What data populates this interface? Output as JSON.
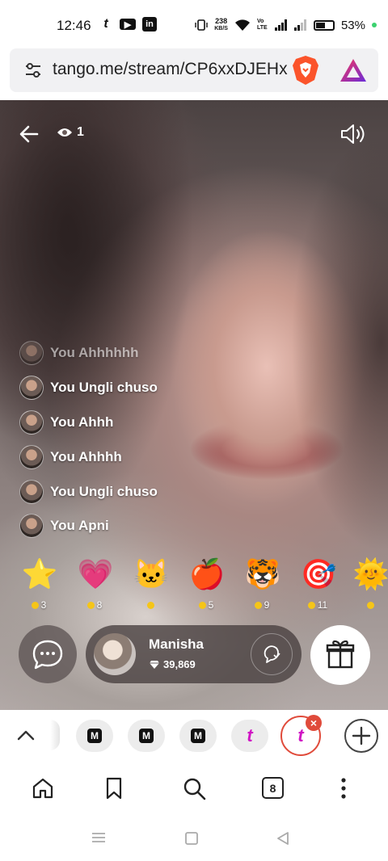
{
  "status_bar": {
    "time": "12:46",
    "left_icons": [
      "tango-icon",
      "youtube-icon",
      "linkedin-icon"
    ],
    "net_speed_value": "238",
    "net_speed_unit": "KB/S",
    "vo_lte": "Vo LTE",
    "battery_percent": "53%",
    "battery_level": 0.53
  },
  "browser": {
    "url": "tango.me/stream/CP6xxDJEHx"
  },
  "stream": {
    "viewer_count": "1",
    "chat": [
      {
        "text": "You Ahhhhhh",
        "faded": true
      },
      {
        "text": "You Ungli chuso",
        "faded": false
      },
      {
        "text": "You Ahhh",
        "faded": false
      },
      {
        "text": "You Ahhhh",
        "faded": false
      },
      {
        "text": "You Ungli chuso",
        "faded": false
      },
      {
        "text": "You Apni",
        "faded": false
      }
    ],
    "gifts": [
      {
        "icon": "star-gift-icon",
        "glyph": "⭐",
        "price": "3"
      },
      {
        "icon": "heart-gift-icon",
        "glyph": "💗",
        "price": "8"
      },
      {
        "icon": "cat-gift-icon",
        "glyph": "🐱",
        "price": ""
      },
      {
        "icon": "apple-gift-icon",
        "glyph": "🍎",
        "price": "5"
      },
      {
        "icon": "tiger-gift-icon",
        "glyph": "🐯",
        "price": "9"
      },
      {
        "icon": "target-gift-icon",
        "glyph": "🎯",
        "price": "11"
      },
      {
        "icon": "sun-gift-icon",
        "glyph": "🌞",
        "price": ""
      }
    ],
    "host": {
      "name": "Manisha",
      "diamonds": "39,869"
    }
  },
  "tabs": {
    "count": "8",
    "chips": [
      "medium-icon",
      "medium-icon",
      "medium-icon",
      "tango-icon"
    ],
    "active": "tango-icon"
  },
  "colors": {
    "accent_red": "#e04b3b",
    "tango_pink": "#d015c4",
    "coin_gold": "#f5c518"
  }
}
